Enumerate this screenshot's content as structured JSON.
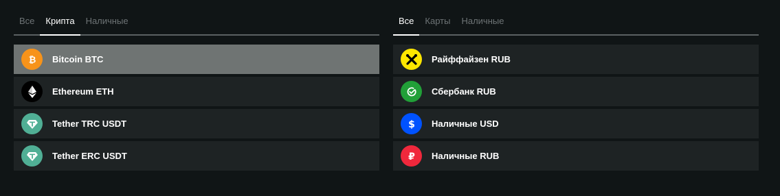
{
  "crypto_panel": {
    "tabs": [
      {
        "label": "Все",
        "active": false
      },
      {
        "label": "Крипта",
        "active": true
      },
      {
        "label": "Наличные",
        "active": false
      }
    ],
    "items": [
      {
        "label": "Bitcoin BTC",
        "icon": "bitcoin-icon",
        "color": "#f7931a",
        "selected": true
      },
      {
        "label": "Ethereum ETH",
        "icon": "ethereum-icon",
        "color": "#000000",
        "selected": false
      },
      {
        "label": "Tether TRC USDT",
        "icon": "tether-icon",
        "color": "#50af95",
        "selected": false
      },
      {
        "label": "Tether ERC USDT",
        "icon": "tether-icon",
        "color": "#50af95",
        "selected": false
      }
    ]
  },
  "payment_panel": {
    "tabs": [
      {
        "label": "Все",
        "active": true
      },
      {
        "label": "Карты",
        "active": false
      },
      {
        "label": "Наличные",
        "active": false
      }
    ],
    "items": [
      {
        "label": "Райффайзен RUB",
        "icon": "raiffeisen-icon",
        "color": "#fee600",
        "selected": false
      },
      {
        "label": "Сбербанк RUB",
        "icon": "sberbank-icon",
        "color": "#21a038",
        "selected": false
      },
      {
        "label": "Наличные USD",
        "icon": "dollar-icon",
        "color": "#0052ff",
        "selected": false
      },
      {
        "label": "Наличные RUB",
        "icon": "ruble-icon",
        "color": "#f0283c",
        "selected": false
      }
    ]
  },
  "colors": {
    "background": "#101516",
    "row": "#1e2324",
    "row_selected": "#6f7473",
    "tab_inactive": "#6e7476",
    "tab_active": "#ffffff"
  }
}
